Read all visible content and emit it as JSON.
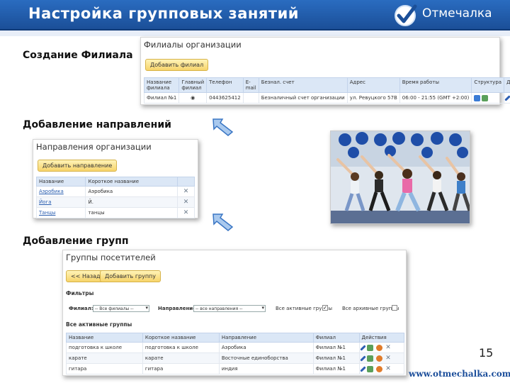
{
  "header": {
    "title": "Настройка групповых занятий",
    "logo_text": "Отмечалка"
  },
  "sections": {
    "branch": "Создание Филиала",
    "directions": "Добавление направлений",
    "groups": "Добавление групп"
  },
  "branches_panel": {
    "title": "Филиалы организации",
    "add_button": "Добавить филиал",
    "columns": [
      "Название филиала",
      "Главный филиал",
      "Телефон",
      "E-mail",
      "Безнал. счет",
      "Адрес",
      "Время работы",
      "Структура",
      "Действия"
    ],
    "rows": [
      {
        "name": "Филиал №1",
        "main": "◉",
        "phone": "0443625412",
        "email": "",
        "account": "Безналичный счет организации",
        "address": "ул. Ревуцкого 57В",
        "hours": "06:00 - 21:55 (GMT +2:00)"
      }
    ]
  },
  "directions_panel": {
    "title": "Направления организации",
    "add_button": "Добавить направление",
    "columns": [
      "Название",
      "Короткое название",
      ""
    ],
    "rows": [
      {
        "name": "Аэробика",
        "short": "Аэробика"
      },
      {
        "name": "Йога",
        "short": "Й."
      },
      {
        "name": "Танцы",
        "short": "танцы"
      }
    ]
  },
  "groups_panel": {
    "title": "Группы посетителей",
    "back_button": "<< Назад",
    "add_button": "Добавить группу",
    "filters_title": "Фильтры",
    "filter_branch_label": "Филиал:",
    "filter_branch_value": "-- Все филиалы --",
    "filter_direction_label": "Направление:",
    "filter_direction_value": "-- все направления --",
    "active_label": "Все активные группы",
    "archive_label": "Все архивные группы",
    "active_checked": "✓",
    "list_title": "Все активные группы",
    "columns": [
      "Название",
      "Короткое название",
      "Направление",
      "Филиал",
      "Действия"
    ],
    "rows": [
      {
        "name": "подготовка к школе",
        "short": "подготовка к школе",
        "direction": "Аэробика",
        "branch": "Филиал №1"
      },
      {
        "name": "карате",
        "short": "карате",
        "direction": "Восточные единоборства",
        "branch": "Филиал №1"
      },
      {
        "name": "гитара",
        "short": "гитара",
        "direction": "индия",
        "branch": "Филиал №1"
      }
    ]
  },
  "page_number": "15",
  "footer_url": "www.otmechalka.com",
  "colors": {
    "header": "#1f5aa8",
    "button": "#f7d46a",
    "table_header": "#dbe7f6",
    "link": "#2b5fb0"
  }
}
